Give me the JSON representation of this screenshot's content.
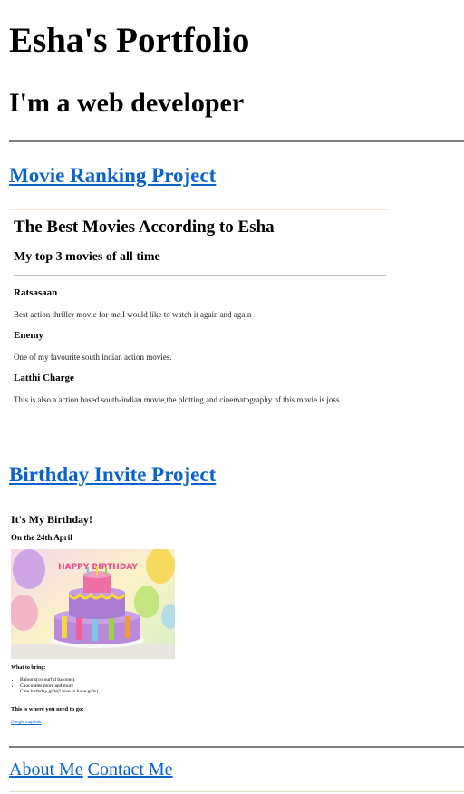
{
  "header": {
    "title": "Esha's Portfolio",
    "subtitle": "I'm a web developer"
  },
  "projects": {
    "movie": {
      "link_label": "Movie Ranking Project",
      "preview": {
        "heading": "The Best Movies According to Esha",
        "subheading": "My top 3 movies of all time",
        "movies": [
          {
            "name": "Ratsasaan",
            "description": "Best action thriller movie for me.I would like to watch it again and again"
          },
          {
            "name": "Enemy",
            "description": "One of my favourite south indian action movies."
          },
          {
            "name": "Latthi Charge",
            "description": "This is also a action based south-indian movie,the plotting and cinematography of this movie is joss."
          }
        ]
      }
    },
    "birthday": {
      "link_label": "Birthday Invite Project",
      "preview": {
        "heading": "It's My Birthday!",
        "date": "On the 24th April",
        "cake_banner": "HAPPY BIRTHDAY",
        "bring_heading": "What to bring:",
        "bring_items": [
          "Baloons(colourful baloons)",
          "Chocolates more and more",
          "Cute birthday gifts(I love to have gifts)"
        ],
        "where_heading": "This is where you need to go:",
        "map_link": "Google map link"
      }
    }
  },
  "footer": {
    "about_label": "About Me",
    "contact_label": "Contact Me"
  },
  "colors": {
    "link": "#0b63ce",
    "rule": "#808080"
  }
}
